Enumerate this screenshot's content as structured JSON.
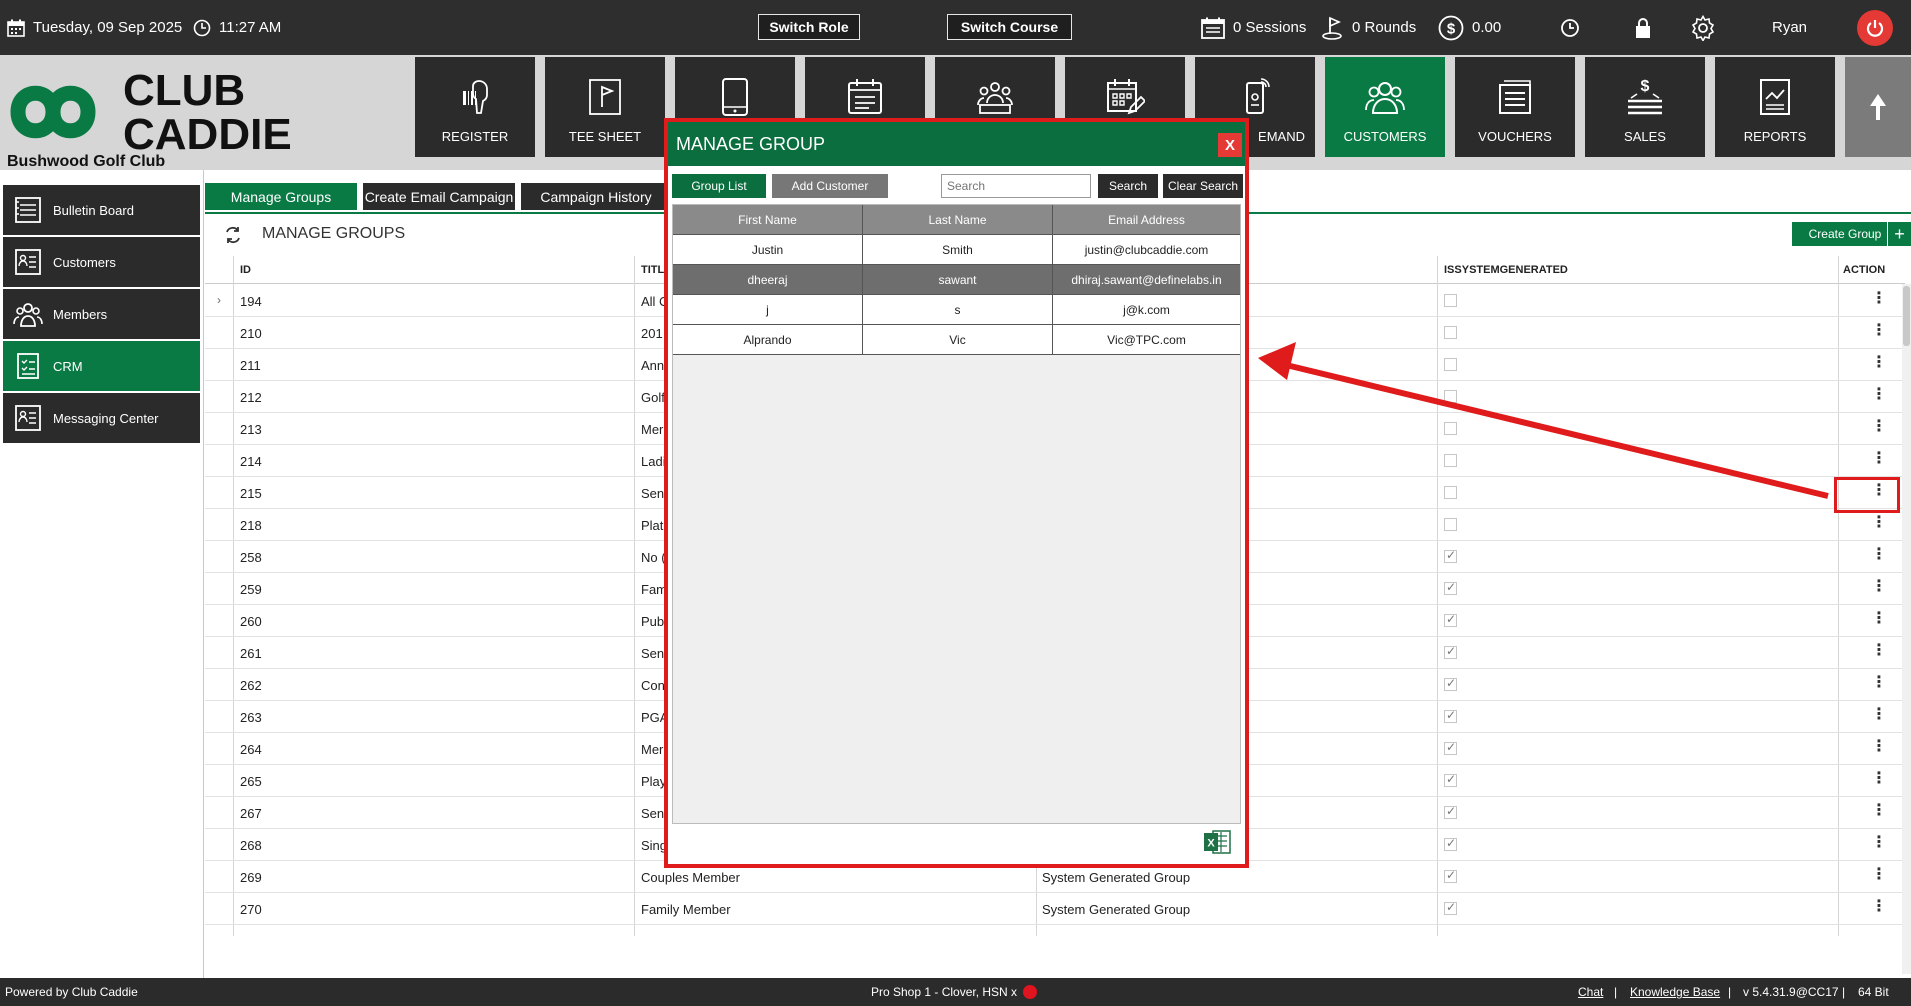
{
  "topbar": {
    "date": "Tuesday,  09 Sep 2025",
    "time": "11:27 AM",
    "switch_role": "Switch Role",
    "switch_course": "Switch Course",
    "sessions": "0 Sessions",
    "rounds": "0 Rounds",
    "balance": "0.00",
    "user": "Ryan"
  },
  "header": {
    "logo_line1": "CLUB",
    "logo_line2": "CADDIE",
    "club_name": "Bushwood Golf Club",
    "nav": [
      {
        "label": "REGISTER",
        "icon": "scanner-icon"
      },
      {
        "label": "TEE SHEET",
        "icon": "flag-icon"
      },
      {
        "label": "",
        "icon": "tablet-icon"
      },
      {
        "label": "",
        "icon": "calendar-list-icon"
      },
      {
        "label": "",
        "icon": "group-meeting-icon"
      },
      {
        "label": "",
        "icon": "calendar-edit-icon"
      },
      {
        "label": "EMAND",
        "icon": "phone-signal-icon"
      },
      {
        "label": "CUSTOMERS",
        "icon": "customers-icon"
      },
      {
        "label": "VOUCHERS",
        "icon": "voucher-icon"
      },
      {
        "label": "SALES",
        "icon": "sales-icon"
      },
      {
        "label": "REPORTS",
        "icon": "reports-icon"
      }
    ]
  },
  "sidebar": {
    "items": [
      {
        "label": "Bulletin Board"
      },
      {
        "label": "Customers"
      },
      {
        "label": "Members"
      },
      {
        "label": "CRM"
      },
      {
        "label": "Messaging Center"
      }
    ]
  },
  "main": {
    "tabs": [
      {
        "label": "Manage Groups"
      },
      {
        "label": "Create Email Campaign"
      },
      {
        "label": "Campaign History"
      }
    ],
    "page_title": "MANAGE GROUPS",
    "create_group": "Create Group",
    "columns": {
      "id": "ID",
      "title": "TITL",
      "system": "ISSYSTEMGENERATED",
      "action": "ACTION"
    },
    "rows": [
      {
        "id": "194",
        "title": "All C",
        "desc": "",
        "sys": false
      },
      {
        "id": "210",
        "title": "201",
        "desc": "",
        "sys": false
      },
      {
        "id": "211",
        "title": "Ann",
        "desc": "",
        "sys": false
      },
      {
        "id": "212",
        "title": "Golf",
        "desc": "",
        "sys": false
      },
      {
        "id": "213",
        "title": "Mer",
        "desc": "",
        "sys": false
      },
      {
        "id": "214",
        "title": "Ladi",
        "desc": "",
        "sys": false
      },
      {
        "id": "215",
        "title": "Sen",
        "desc": "",
        "sys": false
      },
      {
        "id": "218",
        "title": "Plat",
        "desc": "",
        "sys": false
      },
      {
        "id": "258",
        "title": "No (",
        "desc": "",
        "sys": true
      },
      {
        "id": "259",
        "title": "Fam",
        "desc": "",
        "sys": true
      },
      {
        "id": "260",
        "title": "Pub",
        "desc": "",
        "sys": true
      },
      {
        "id": "261",
        "title": "Sen",
        "desc": "",
        "sys": true
      },
      {
        "id": "262",
        "title": "Con",
        "desc": "",
        "sys": true
      },
      {
        "id": "263",
        "title": "PGA",
        "desc": "",
        "sys": true
      },
      {
        "id": "264",
        "title": "Mer",
        "desc": "",
        "sys": true
      },
      {
        "id": "265",
        "title": "Play",
        "desc": "",
        "sys": true
      },
      {
        "id": "267",
        "title": "Sen",
        "desc": "",
        "sys": true
      },
      {
        "id": "268",
        "title": "Sing",
        "desc": "",
        "sys": true
      },
      {
        "id": "269",
        "title": "Couples Member",
        "desc": "System Generated Group",
        "sys": true
      },
      {
        "id": "270",
        "title": "Family Member",
        "desc": "System Generated Group",
        "sys": true
      }
    ]
  },
  "modal": {
    "title": "MANAGE GROUP",
    "close": "X",
    "group_list": "Group List",
    "add_customer": "Add Customer",
    "search_placeholder": "Search",
    "search": "Search",
    "clear_search": "Clear Search",
    "columns": [
      "First Name",
      "Last Name",
      "Email Address"
    ],
    "rows": [
      [
        "Justin",
        "Smith",
        "justin@clubcaddie.com"
      ],
      [
        "dheeraj",
        "sawant",
        "dhiraj.sawant@definelabs.in"
      ],
      [
        "j",
        "s",
        "j@k.com"
      ],
      [
        "Alprando",
        "Vic",
        "Vic@TPC.com"
      ]
    ],
    "selected_row": 1
  },
  "footer": {
    "powered": "Powered by Club Caddie",
    "station": "Pro Shop 1 - Clover, HSN x",
    "chat": "Chat",
    "kb": "Knowledge Base",
    "version": "v 5.4.31.9@CC17",
    "bits": "64 Bit",
    "sep": "|"
  },
  "colors": {
    "brand_green": "#0a7a45",
    "dark": "#2b2b2b",
    "annotation_red": "#e01b1b"
  }
}
